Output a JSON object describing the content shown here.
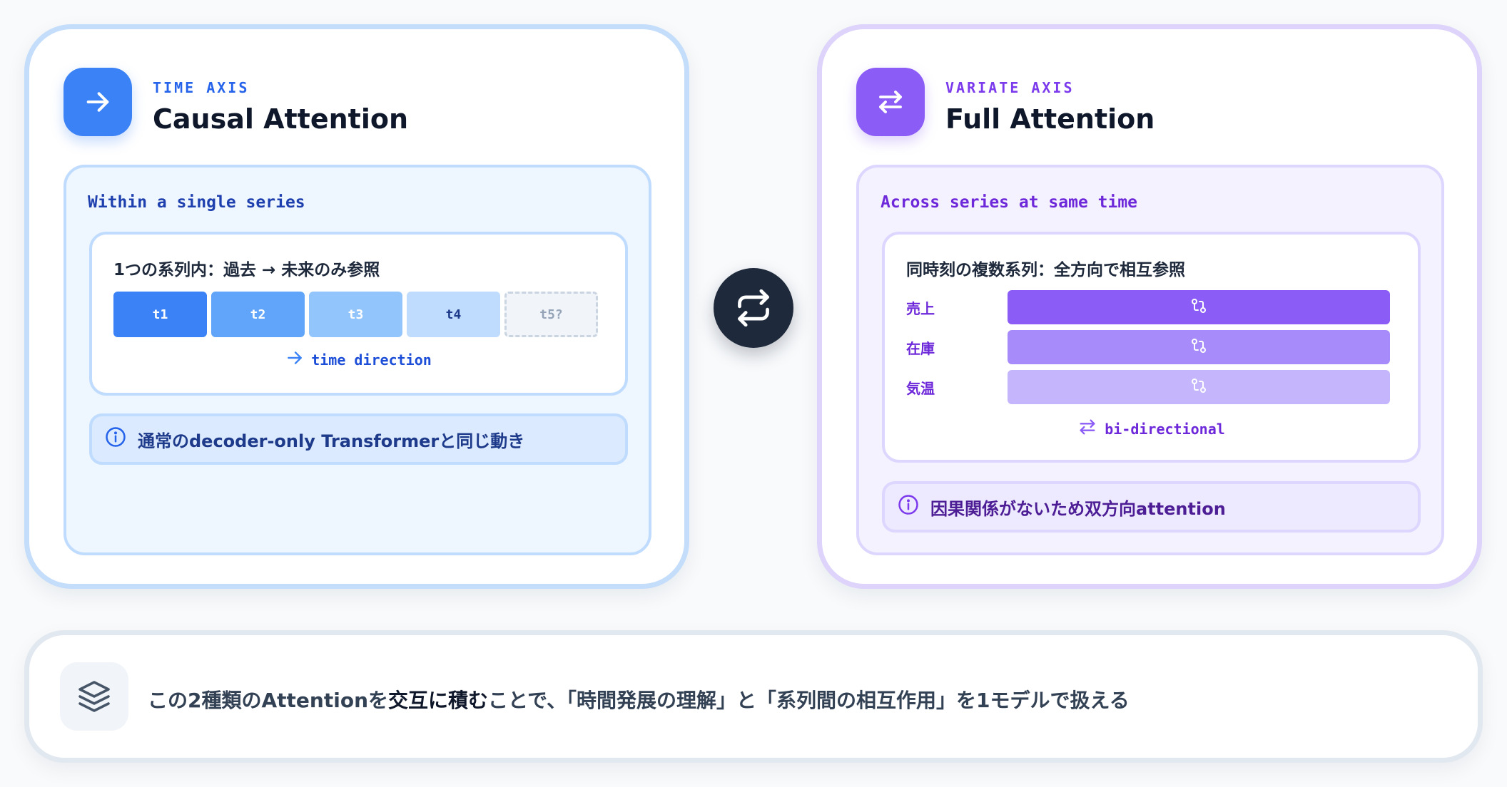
{
  "left_card": {
    "axis_label": "TIME AXIS",
    "title": "Causal Attention",
    "heading": "Within a single series",
    "subtitle": "1つの系列内：過去 → 未来のみ参照",
    "tokens": [
      "t1",
      "t2",
      "t3",
      "t4",
      "t5?"
    ],
    "direction_label": "time direction",
    "note": "通常のdecoder-only Transformerと同じ動き",
    "accent_color": "#3b82f6",
    "icon": "arrow-right-icon"
  },
  "right_card": {
    "axis_label": "VARIATE AXIS",
    "title": "Full Attention",
    "heading": "Across series at same time",
    "subtitle": "同時刻の複数系列：全方向で相互参照",
    "variates": [
      "売上",
      "在庫",
      "気温"
    ],
    "direction_label": "bi-directional",
    "note": "因果関係がないため双方向attention",
    "accent_color": "#8b5cf6",
    "icon": "arrows-left-right-icon"
  },
  "center": {
    "icon": "repeat-icon"
  },
  "bottom": {
    "icon": "layers-icon",
    "text_before": "この2種類のAttentionを",
    "text_emphasis": "交互に積む",
    "text_after": "ことで、「時間発展の理解」と「系列間の相互作用」を1モデルで扱える"
  }
}
